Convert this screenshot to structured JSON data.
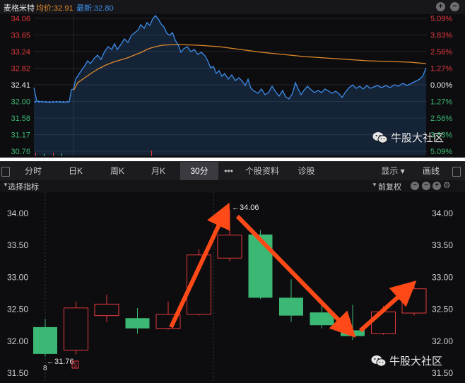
{
  "stock": {
    "name": "麦格米特",
    "avg_price": "均价:32.91",
    "latest_price": "最新:32.80"
  },
  "intraday": {
    "price_labels": [
      "34.06",
      "33.65",
      "33.24",
      "32.82",
      "32.41",
      "32.00",
      "31.58",
      "31.17",
      "30.76"
    ],
    "pct_labels": [
      "5.09%",
      "3.83%",
      "2.56%",
      "1.27%",
      "0.00%",
      "1.27%",
      "2.56%",
      "3.83%",
      "5.09%"
    ],
    "colors": {
      "up": "#e4393c",
      "down": "#3bb873",
      "neutral": "#e8e8e8",
      "price_line": "#3d8de8",
      "avg_line": "#e08a2a"
    }
  },
  "tabs": [
    {
      "label": "分时",
      "active": false
    },
    {
      "label": "日K",
      "active": false
    },
    {
      "label": "周K",
      "active": false
    },
    {
      "label": "月K",
      "active": false
    },
    {
      "label": "30分",
      "active": true
    },
    {
      "label": "•••",
      "active": false
    },
    {
      "label": "个股资料",
      "active": false
    },
    {
      "label": "诊股",
      "active": false
    }
  ],
  "tabs_right": {
    "display": "显示",
    "draw": "画线"
  },
  "indicator_bar": {
    "select_label": "选择指标",
    "adjust_label": "前复权"
  },
  "kline": {
    "y_labels": [
      "34.00",
      "33.50",
      "33.00",
      "32.50",
      "32.00",
      "31.50"
    ],
    "high_label": "←34.06",
    "low_label": "←31.76",
    "date_label": "8",
    "badge_label": "5",
    "candles": [
      {
        "open": 32.22,
        "close": 31.8,
        "high": 32.35,
        "low": 31.76
      },
      {
        "open": 31.86,
        "close": 32.52,
        "high": 32.62,
        "low": 31.79
      },
      {
        "open": 32.4,
        "close": 32.58,
        "high": 32.73,
        "low": 32.3
      },
      {
        "open": 32.36,
        "close": 32.2,
        "high": 32.52,
        "low": 32.12
      },
      {
        "open": 32.2,
        "close": 32.42,
        "high": 32.62,
        "low": 32.18
      },
      {
        "open": 32.42,
        "close": 33.35,
        "high": 33.44,
        "low": 32.4
      },
      {
        "open": 33.3,
        "close": 33.66,
        "high": 34.06,
        "low": 33.25
      },
      {
        "open": 33.67,
        "close": 32.68,
        "high": 33.74,
        "low": 32.66
      },
      {
        "open": 32.68,
        "close": 32.4,
        "high": 32.97,
        "low": 32.3
      },
      {
        "open": 32.45,
        "close": 32.25,
        "high": 32.62,
        "low": 32.2
      },
      {
        "open": 32.17,
        "close": 32.08,
        "high": 32.57,
        "low": 32.02
      },
      {
        "open": 32.12,
        "close": 32.46,
        "high": 32.55,
        "low": 32.1
      },
      {
        "open": 32.44,
        "close": 32.82,
        "high": 32.92,
        "low": 32.4
      }
    ]
  },
  "watermark": {
    "text": "牛股大社区"
  }
}
